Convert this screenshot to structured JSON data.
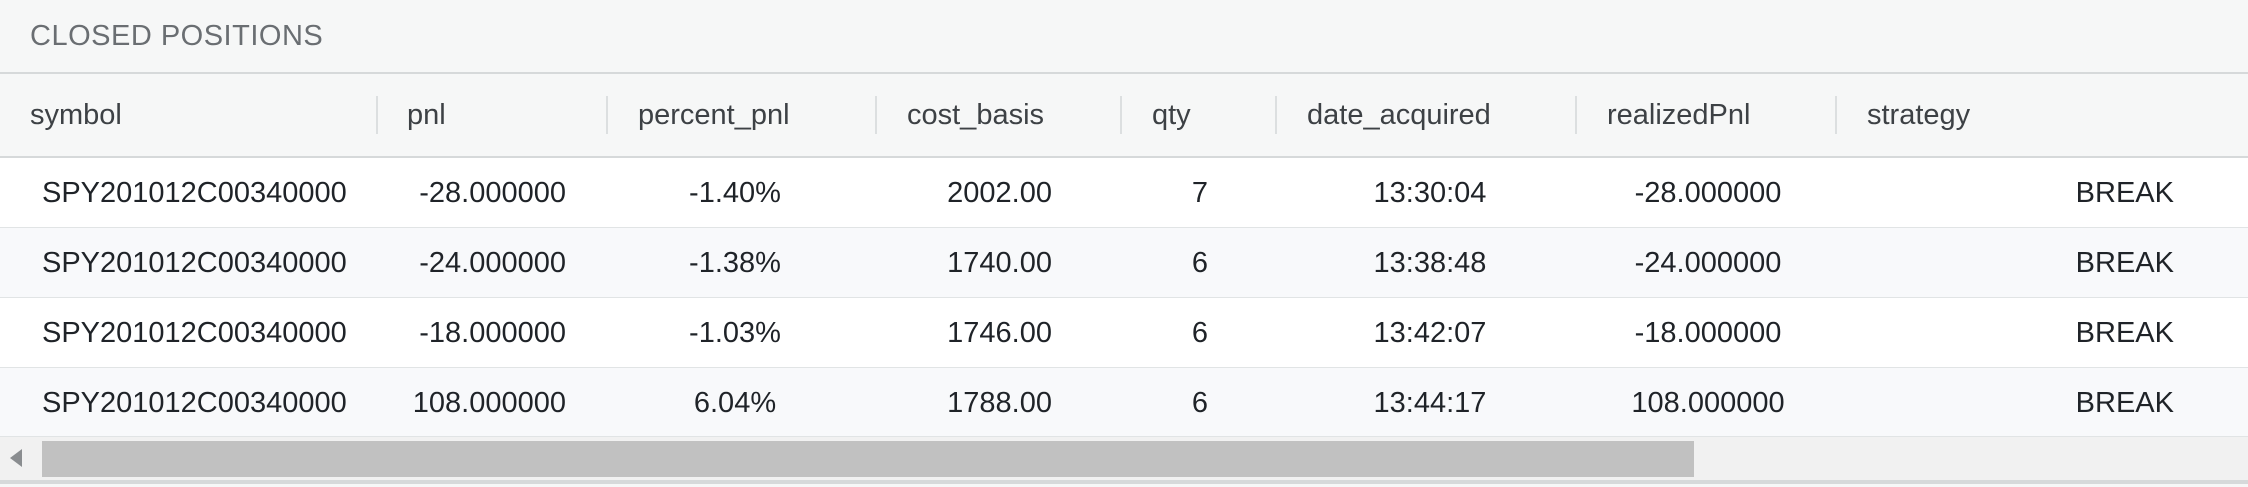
{
  "panel": {
    "title": "CLOSED POSITIONS"
  },
  "columns": [
    "symbol",
    "pnl",
    "percent_pnl",
    "cost_basis",
    "qty",
    "date_acquired",
    "realizedPnl",
    "strategy"
  ],
  "rows": [
    [
      "SPY201012C00340000",
      "-28.000000",
      "-1.40%",
      "2002.00",
      "7",
      "13:30:04",
      "-28.000000",
      "BREAK"
    ],
    [
      "SPY201012C00340000",
      "-24.000000",
      "-1.38%",
      "1740.00",
      "6",
      "13:38:48",
      "-24.000000",
      "BREAK"
    ],
    [
      "SPY201012C00340000",
      "-18.000000",
      "-1.03%",
      "1746.00",
      "6",
      "13:42:07",
      "-18.000000",
      "BREAK"
    ],
    [
      "SPY201012C00340000",
      "108.000000",
      "6.04%",
      "1788.00",
      "6",
      "13:44:17",
      "108.000000",
      "BREAK"
    ]
  ],
  "scrollbar": {
    "position": 0,
    "visible_fraction": 0.74,
    "left_arrow_icon": "triangle-left-icon"
  }
}
